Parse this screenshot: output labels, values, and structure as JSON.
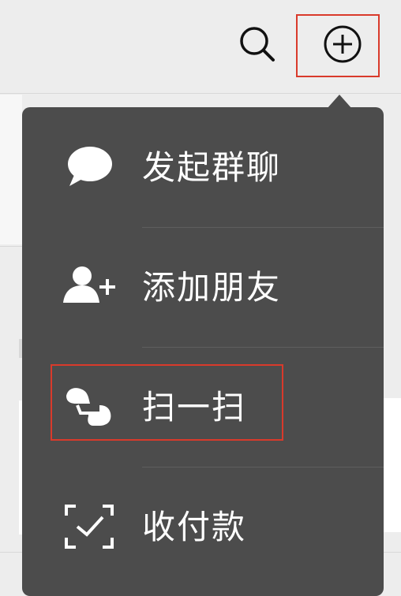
{
  "header": {
    "search_icon": "search-icon",
    "add_icon": "plus-circle-icon"
  },
  "menu": {
    "items": [
      {
        "label": "发起群聊",
        "icon": "chat-bubble-icon"
      },
      {
        "label": "添加朋友",
        "icon": "add-friend-icon"
      },
      {
        "label": "扫一扫",
        "icon": "scan-icon"
      },
      {
        "label": "收付款",
        "icon": "money-scan-icon"
      }
    ]
  },
  "colors": {
    "menu_background": "#4c4c4c",
    "menu_text": "#ffffff",
    "highlight": "#d93a2b",
    "topbar_background": "#ededed"
  }
}
